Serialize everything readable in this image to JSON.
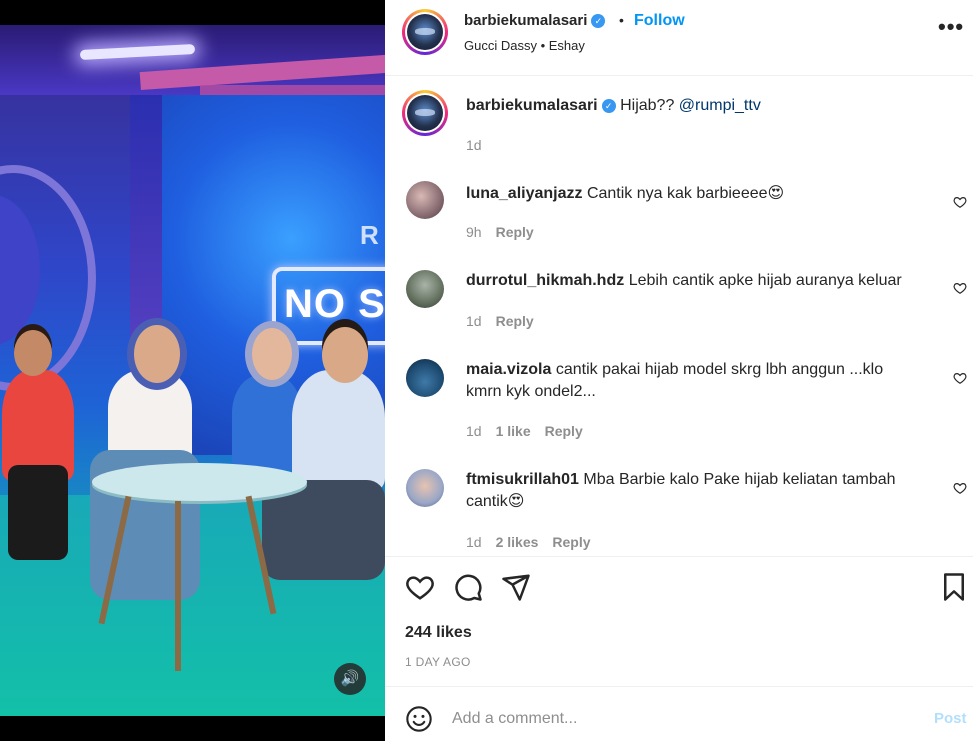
{
  "post": {
    "username": "barbiekumalasari",
    "follow_label": "Follow",
    "dot": "•",
    "audio": "Gucci Dassy • Eshay",
    "more_label": "•••"
  },
  "video": {
    "sign_text": "NO S",
    "sign_top": "R"
  },
  "caption": {
    "username": "barbiekumalasari",
    "text": "Hijab?? ",
    "mention": "@rumpi_ttv",
    "time": "1d"
  },
  "comments": [
    {
      "username": "luna_aliyanjazz",
      "text": "Cantik nya kak barbieeee😍",
      "time": "9h",
      "likes": "",
      "reply": "Reply"
    },
    {
      "username": "durrotul_hikmah.hdz",
      "text": "Lebih cantik apke hijab auranya keluar",
      "time": "1d",
      "likes": "",
      "reply": "Reply"
    },
    {
      "username": "maia.vizola",
      "text": "cantik pakai hijab model skrg lbh anggun ...klo kmrn kyk ondel2...",
      "time": "1d",
      "likes": "1 like",
      "reply": "Reply"
    },
    {
      "username": "ftmisukrillah01",
      "text": "Mba Barbie kalo Pake hijab keliatan tambah cantik😍",
      "time": "1d",
      "likes": "2 likes",
      "reply": "Reply"
    }
  ],
  "actions": {
    "likes": "244 likes",
    "date": "1 DAY AGO"
  },
  "add_comment": {
    "placeholder": "Add a comment...",
    "post_label": "Post"
  },
  "colors": {
    "accent": "#0095f6",
    "verified": "#3897f0",
    "muted": "#8e8e8e",
    "post_disabled": "#b2dffc"
  },
  "icons": [
    "more-icon",
    "heart-icon",
    "comment-icon",
    "share-icon",
    "bookmark-icon",
    "emoji-icon",
    "sound-icon",
    "verified-icon"
  ]
}
